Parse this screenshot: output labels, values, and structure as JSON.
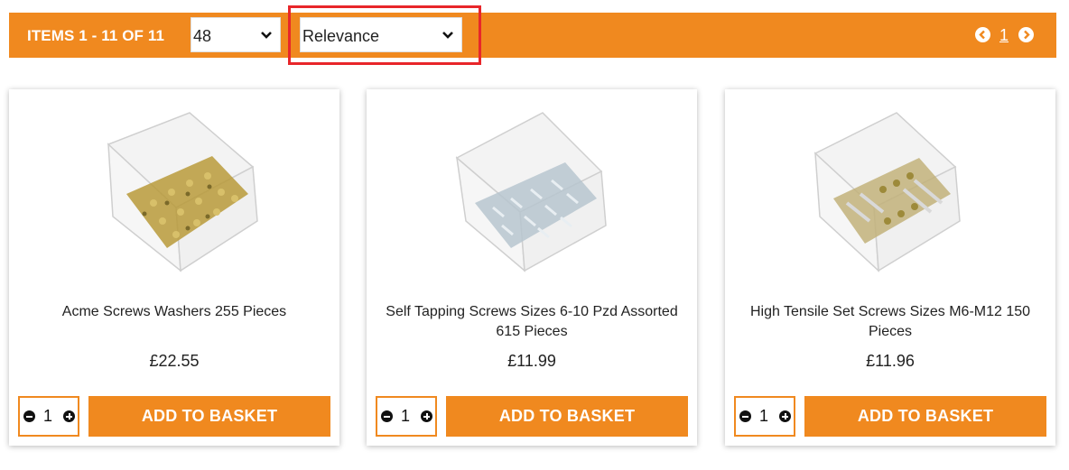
{
  "toolbar": {
    "items_count": "ITEMS 1 - 11 OF 11",
    "per_page": "48",
    "sort_by": "Relevance",
    "current_page": "1",
    "accent_color": "#f0891f",
    "highlight_color": "#e8262a"
  },
  "products": [
    {
      "title_line1": "Acme Screws Washers 255 Pieces",
      "title_line2": "",
      "price": "£22.55",
      "qty": "1",
      "button": "ADD TO BASKET",
      "image": "assorted-brass-screws-box"
    },
    {
      "title_line1": "Self Tapping Screws Sizes 6-10 Pzd Assorted",
      "title_line2": "615 Pieces",
      "price": "£11.99",
      "qty": "1",
      "button": "ADD TO BASKET",
      "image": "assorted-silver-screws-box"
    },
    {
      "title_line1": "High Tensile Set Screws Sizes M6-M12 150",
      "title_line2": "Pieces",
      "price": "£11.96",
      "qty": "1",
      "button": "ADD TO BASKET",
      "image": "assorted-mixed-bolts-box"
    }
  ]
}
